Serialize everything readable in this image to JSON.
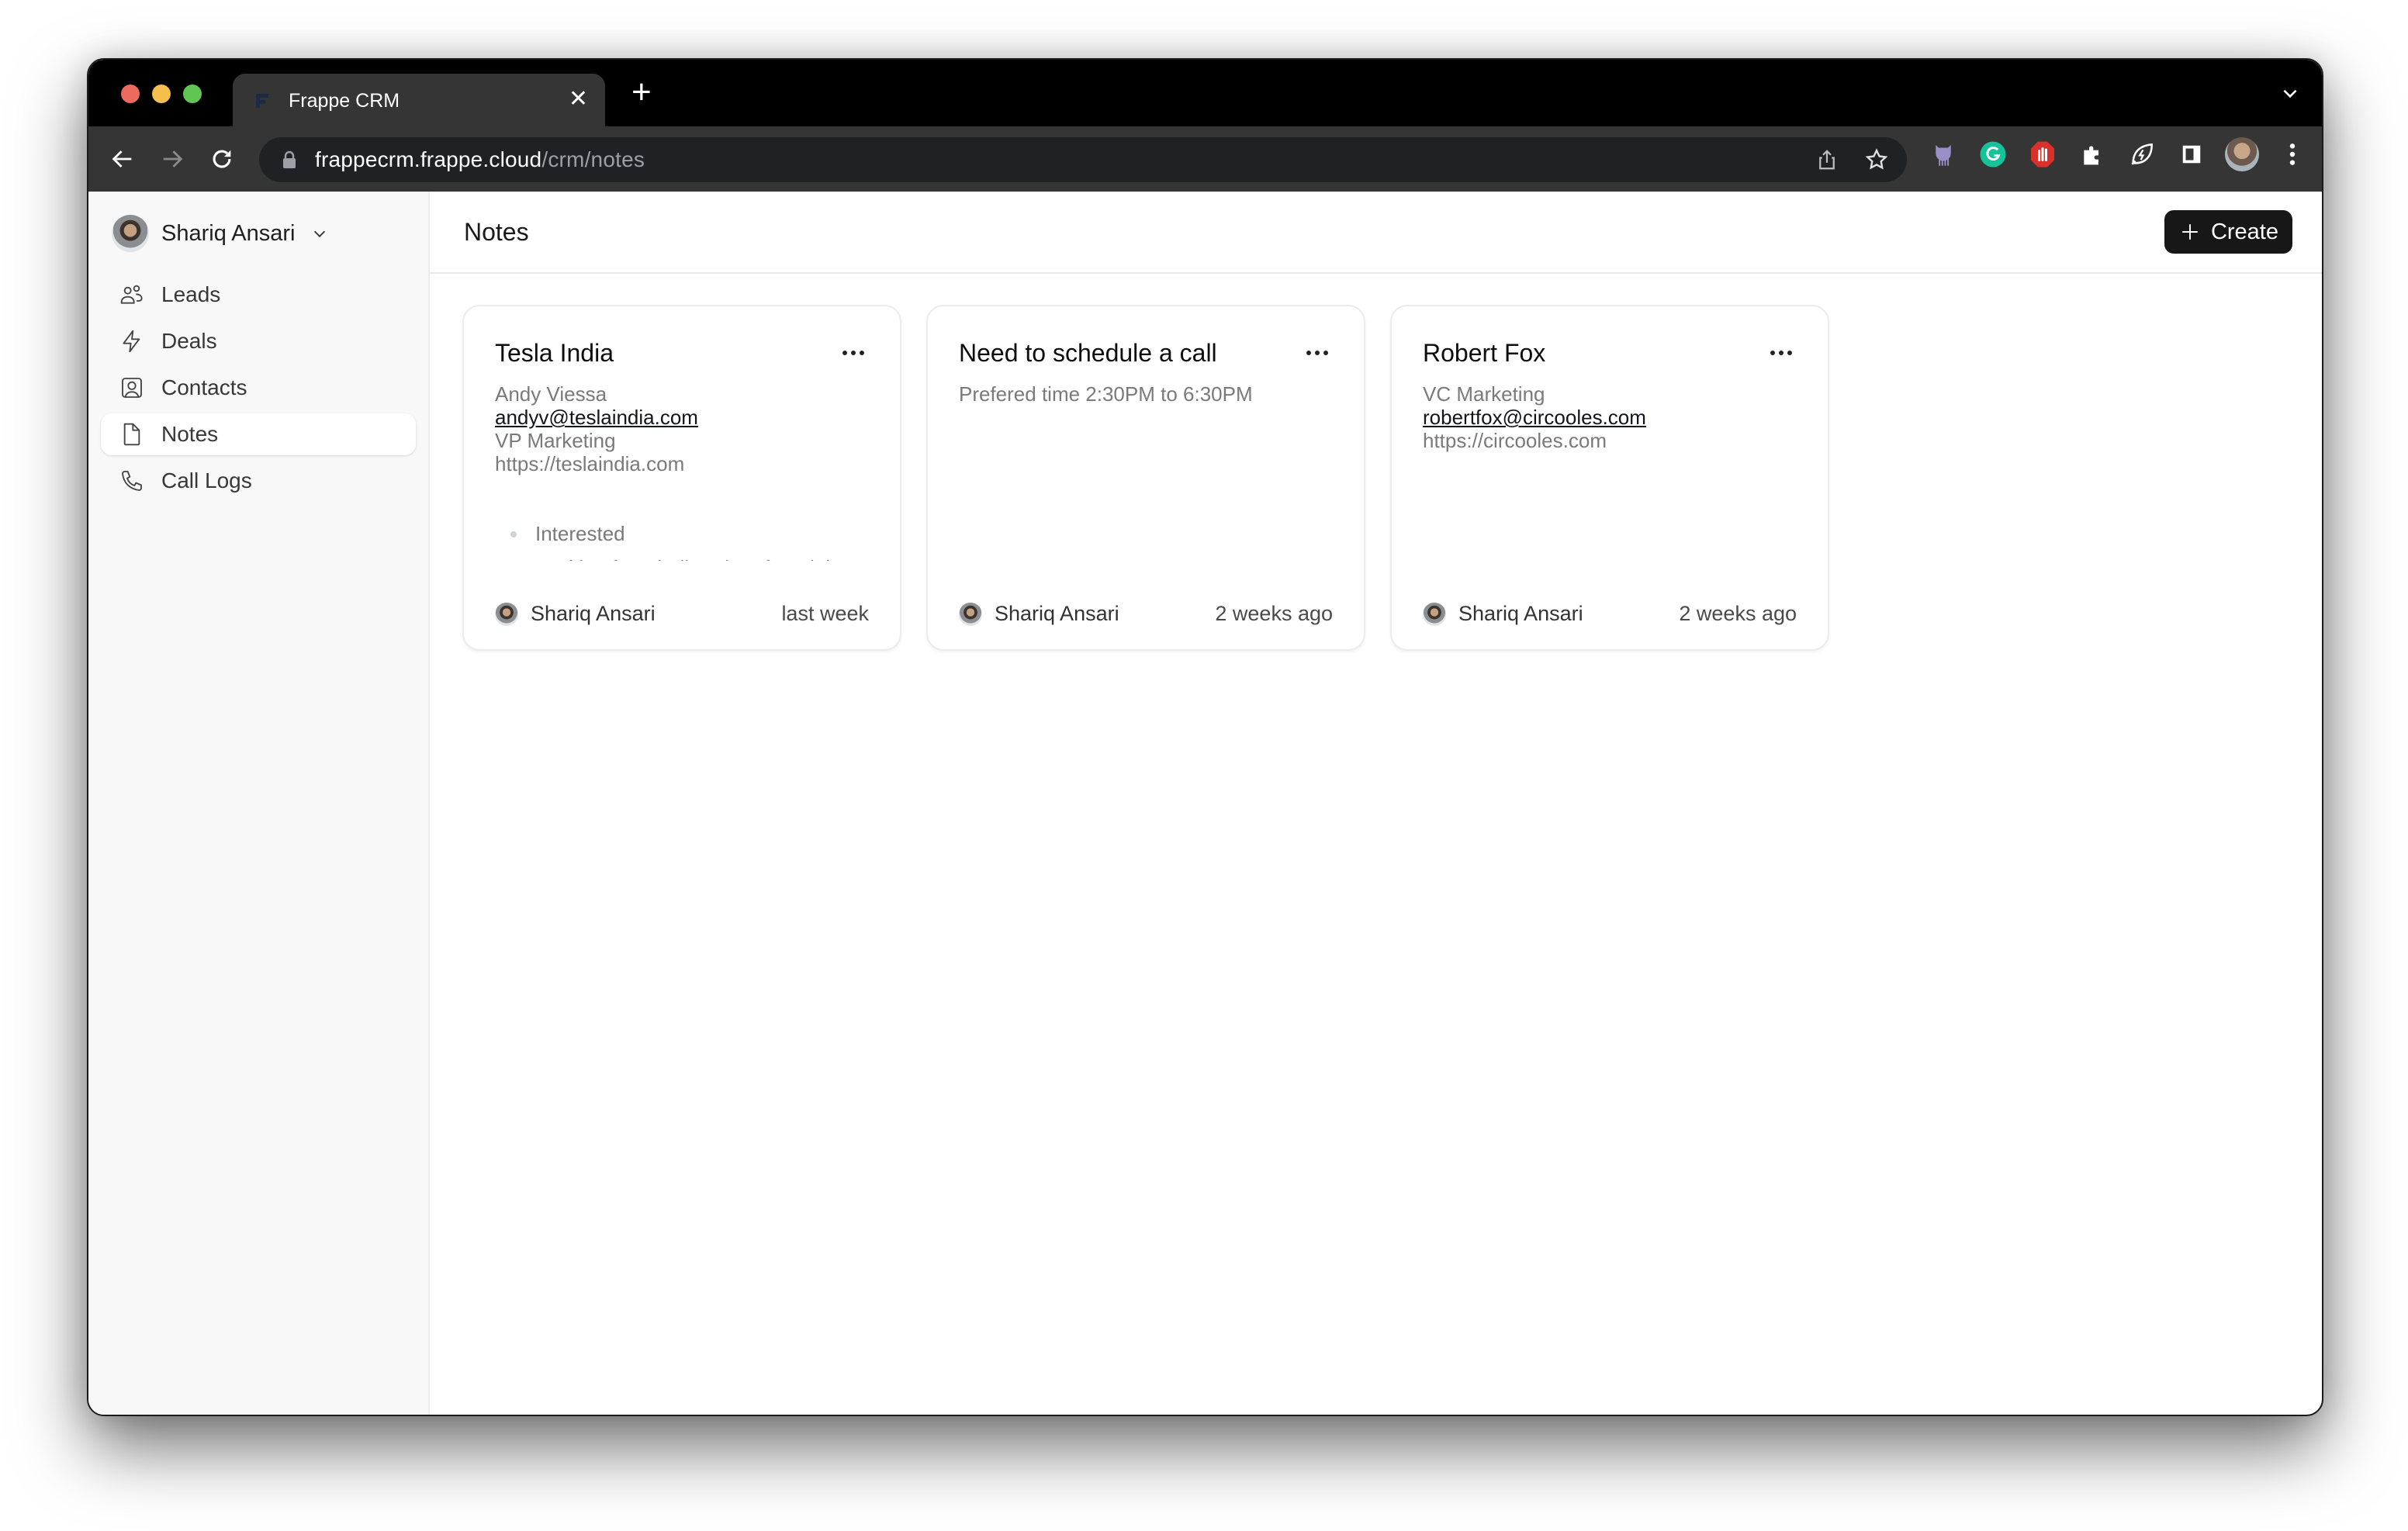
{
  "browser": {
    "tab_title": "Frappe CRM",
    "url_host": "frappecrm.frappe.cloud",
    "url_path": "/crm/notes",
    "extensions": [
      "octopus-extension-icon",
      "grammarly-icon",
      "adblock-icon",
      "puzzle-extensions-icon",
      "leaf-bolt-icon",
      "sidebar-toggle-icon"
    ]
  },
  "sidebar": {
    "user_name": "Shariq Ansari",
    "items": [
      {
        "label": "Leads",
        "icon": "users-icon",
        "active": false
      },
      {
        "label": "Deals",
        "icon": "lightning-icon",
        "active": false
      },
      {
        "label": "Contacts",
        "icon": "contact-card-icon",
        "active": false
      },
      {
        "label": "Notes",
        "icon": "file-icon",
        "active": true
      },
      {
        "label": "Call Logs",
        "icon": "phone-icon",
        "active": false
      }
    ]
  },
  "header": {
    "title": "Notes",
    "create_label": "Create"
  },
  "notes": [
    {
      "title": "Tesla India",
      "lines": [
        "Andy Viessa",
        "andyv@teslaindia.com",
        "VP Marketing",
        "https://teslaindia.com"
      ],
      "email_index": 1,
      "bullets": [
        "Interested",
        "Looking for a bulk order of Model"
      ],
      "author": "Shariq Ansari",
      "time": "last week"
    },
    {
      "title": "Need to schedule a call",
      "lines": [
        "Prefered time 2:30PM to 6:30PM"
      ],
      "email_index": -1,
      "bullets": [],
      "author": "Shariq Ansari",
      "time": "2 weeks ago"
    },
    {
      "title": "Robert Fox",
      "lines": [
        "VC Marketing",
        "robertfox@circooles.com",
        "https://circooles.com"
      ],
      "email_index": 1,
      "bullets": [],
      "author": "Shariq Ansari",
      "time": "2 weeks ago"
    }
  ],
  "colors": {
    "create_button_bg": "#171717",
    "sidebar_bg": "#f8f8f8",
    "chrome_bg": "#353535"
  }
}
